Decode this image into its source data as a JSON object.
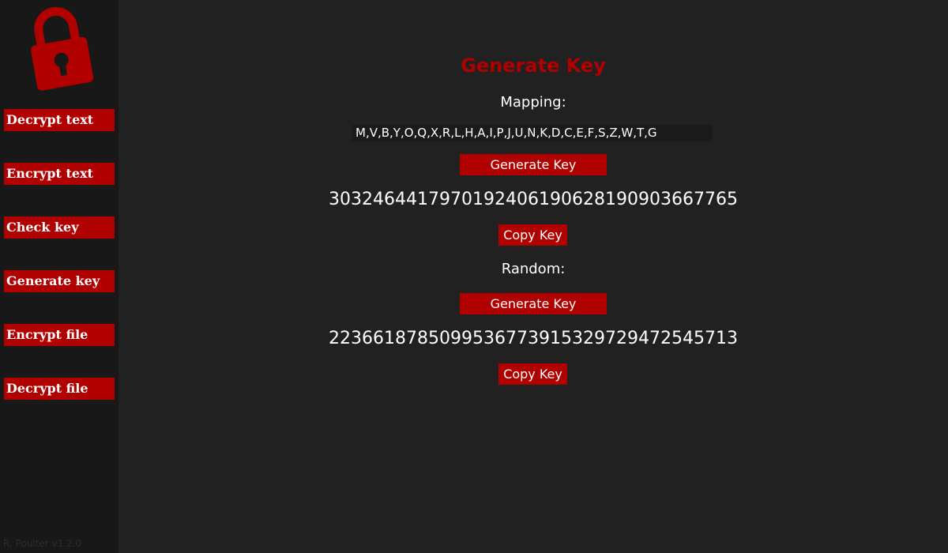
{
  "app": {
    "footer": "R. Poulter v1.2.0"
  },
  "sidebar": {
    "items": [
      {
        "label": "Decrypt text"
      },
      {
        "label": "Encrypt text"
      },
      {
        "label": "Check key"
      },
      {
        "label": "Generate key"
      },
      {
        "label": "Encrypt file"
      },
      {
        "label": "Decrypt file"
      }
    ]
  },
  "main": {
    "title": "Generate Key",
    "mapping": {
      "label": "Mapping:",
      "value": "M,V,B,Y,O,Q,X,R,L,H,A,I,P,J,U,N,K,D,C,E,F,S,Z,W,T,G",
      "generate_label": "Generate Key",
      "key": "30324644179701924061906281909036677​65",
      "copy_label": "Copy Key"
    },
    "random": {
      "label": "Random:",
      "generate_label": "Generate Key",
      "key": "22366187850995367739153297294725457​13",
      "copy_label": "Copy Key"
    }
  },
  "colors": {
    "accent": "#b00000",
    "background": "#212121",
    "sidebar": "#181818",
    "text": "#ffffff"
  },
  "icons": {
    "logo": "padlock-icon"
  }
}
